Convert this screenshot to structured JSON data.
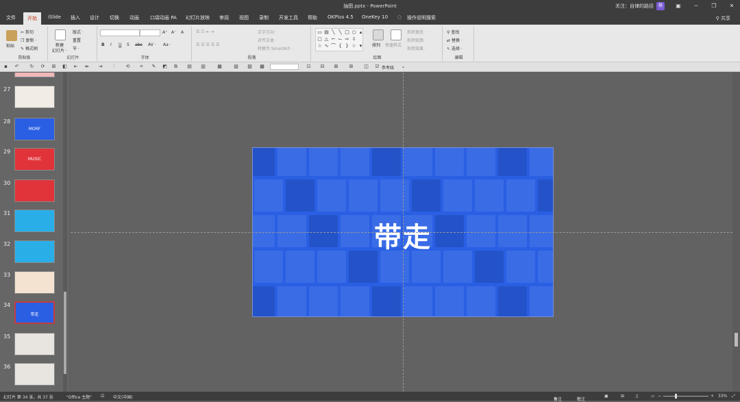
{
  "window": {
    "title": "抽图.pptx  -  PowerPoint",
    "user": "关注：自律的路径",
    "avatar": "杨",
    "minimize": "─",
    "restore": "❐",
    "close": "✕",
    "ribbon_opts": "▣"
  },
  "tabs": [
    "文件",
    "开始",
    "iSlide",
    "插入",
    "设计",
    "切换",
    "动画",
    "口袋动画 PA",
    "幻灯片放映",
    "审阅",
    "视图",
    "录制",
    "开发工具",
    "帮助",
    "OKPlus 4.5",
    "OneKey 10",
    "操作说明搜索"
  ],
  "active_tab": "开始",
  "share_label": "共享",
  "ribbon": {
    "clipboard": {
      "paste": "粘贴",
      "cut": "剪切",
      "copy": "复制 ·",
      "format_painter": "格式刷",
      "label": "剪贴板"
    },
    "slides": {
      "new_slide": "新建",
      "new_slide2": "幻灯片 ·",
      "layout": "版式 ·",
      "reset": "重置",
      "section": "节 ·",
      "label": "幻灯片"
    },
    "font": {
      "label": "字体",
      "bold": "B",
      "italic": "I",
      "underline": "U",
      "shadow": "S",
      "strike": "abc",
      "spacing": "AV ·",
      "case": "Aa ·",
      "grow": "A⁺",
      "shrink": "A⁻",
      "clear": "A"
    },
    "paragraph": {
      "label": "段落",
      "text_dir": "文字方向 ·",
      "align_text": "对齐文本 ·",
      "smartart": "转换为 SmartArt ·"
    },
    "drawing": {
      "label": "绘图",
      "arrange": "排列",
      "quick_styles": "快速样式",
      "fill": "形状填充 ·",
      "outline": "形状轮廓 ·",
      "effects": "形状效果 ·"
    },
    "editing": {
      "label": "编辑",
      "find": "查找",
      "replace": "替换 ·",
      "select": "选择 ·"
    }
  },
  "qat": {
    "guides_label": "参考线"
  },
  "thumbnails": [
    {
      "num": "27",
      "color": "#f2ece6",
      "text": ""
    },
    {
      "num": "28",
      "color": "#2a5fe3",
      "text": "MORF"
    },
    {
      "num": "29",
      "color": "#e0343a",
      "text": "MUSIC"
    },
    {
      "num": "30",
      "color": "#e0343a",
      "text": ""
    },
    {
      "num": "31",
      "color": "#29aee8",
      "text": ""
    },
    {
      "num": "32",
      "color": "#29aee8",
      "text": ""
    },
    {
      "num": "33",
      "color": "#f3e3d0",
      "text": ""
    },
    {
      "num": "34",
      "color": "#2a5fe3",
      "text": "带走"
    },
    {
      "num": "35",
      "color": "#e8e4df",
      "text": ""
    },
    {
      "num": "36",
      "color": "#e8e4df",
      "text": ""
    }
  ],
  "slide": {
    "title": "带走",
    "bg": "#2a5fe3"
  },
  "status": {
    "slide_info": "幻灯片 第 34 张，共 37 张",
    "theme": "\"Office 主题\"",
    "language": "中文(中国)",
    "notes": "备注",
    "comments": "批注",
    "zoom": "33%"
  }
}
